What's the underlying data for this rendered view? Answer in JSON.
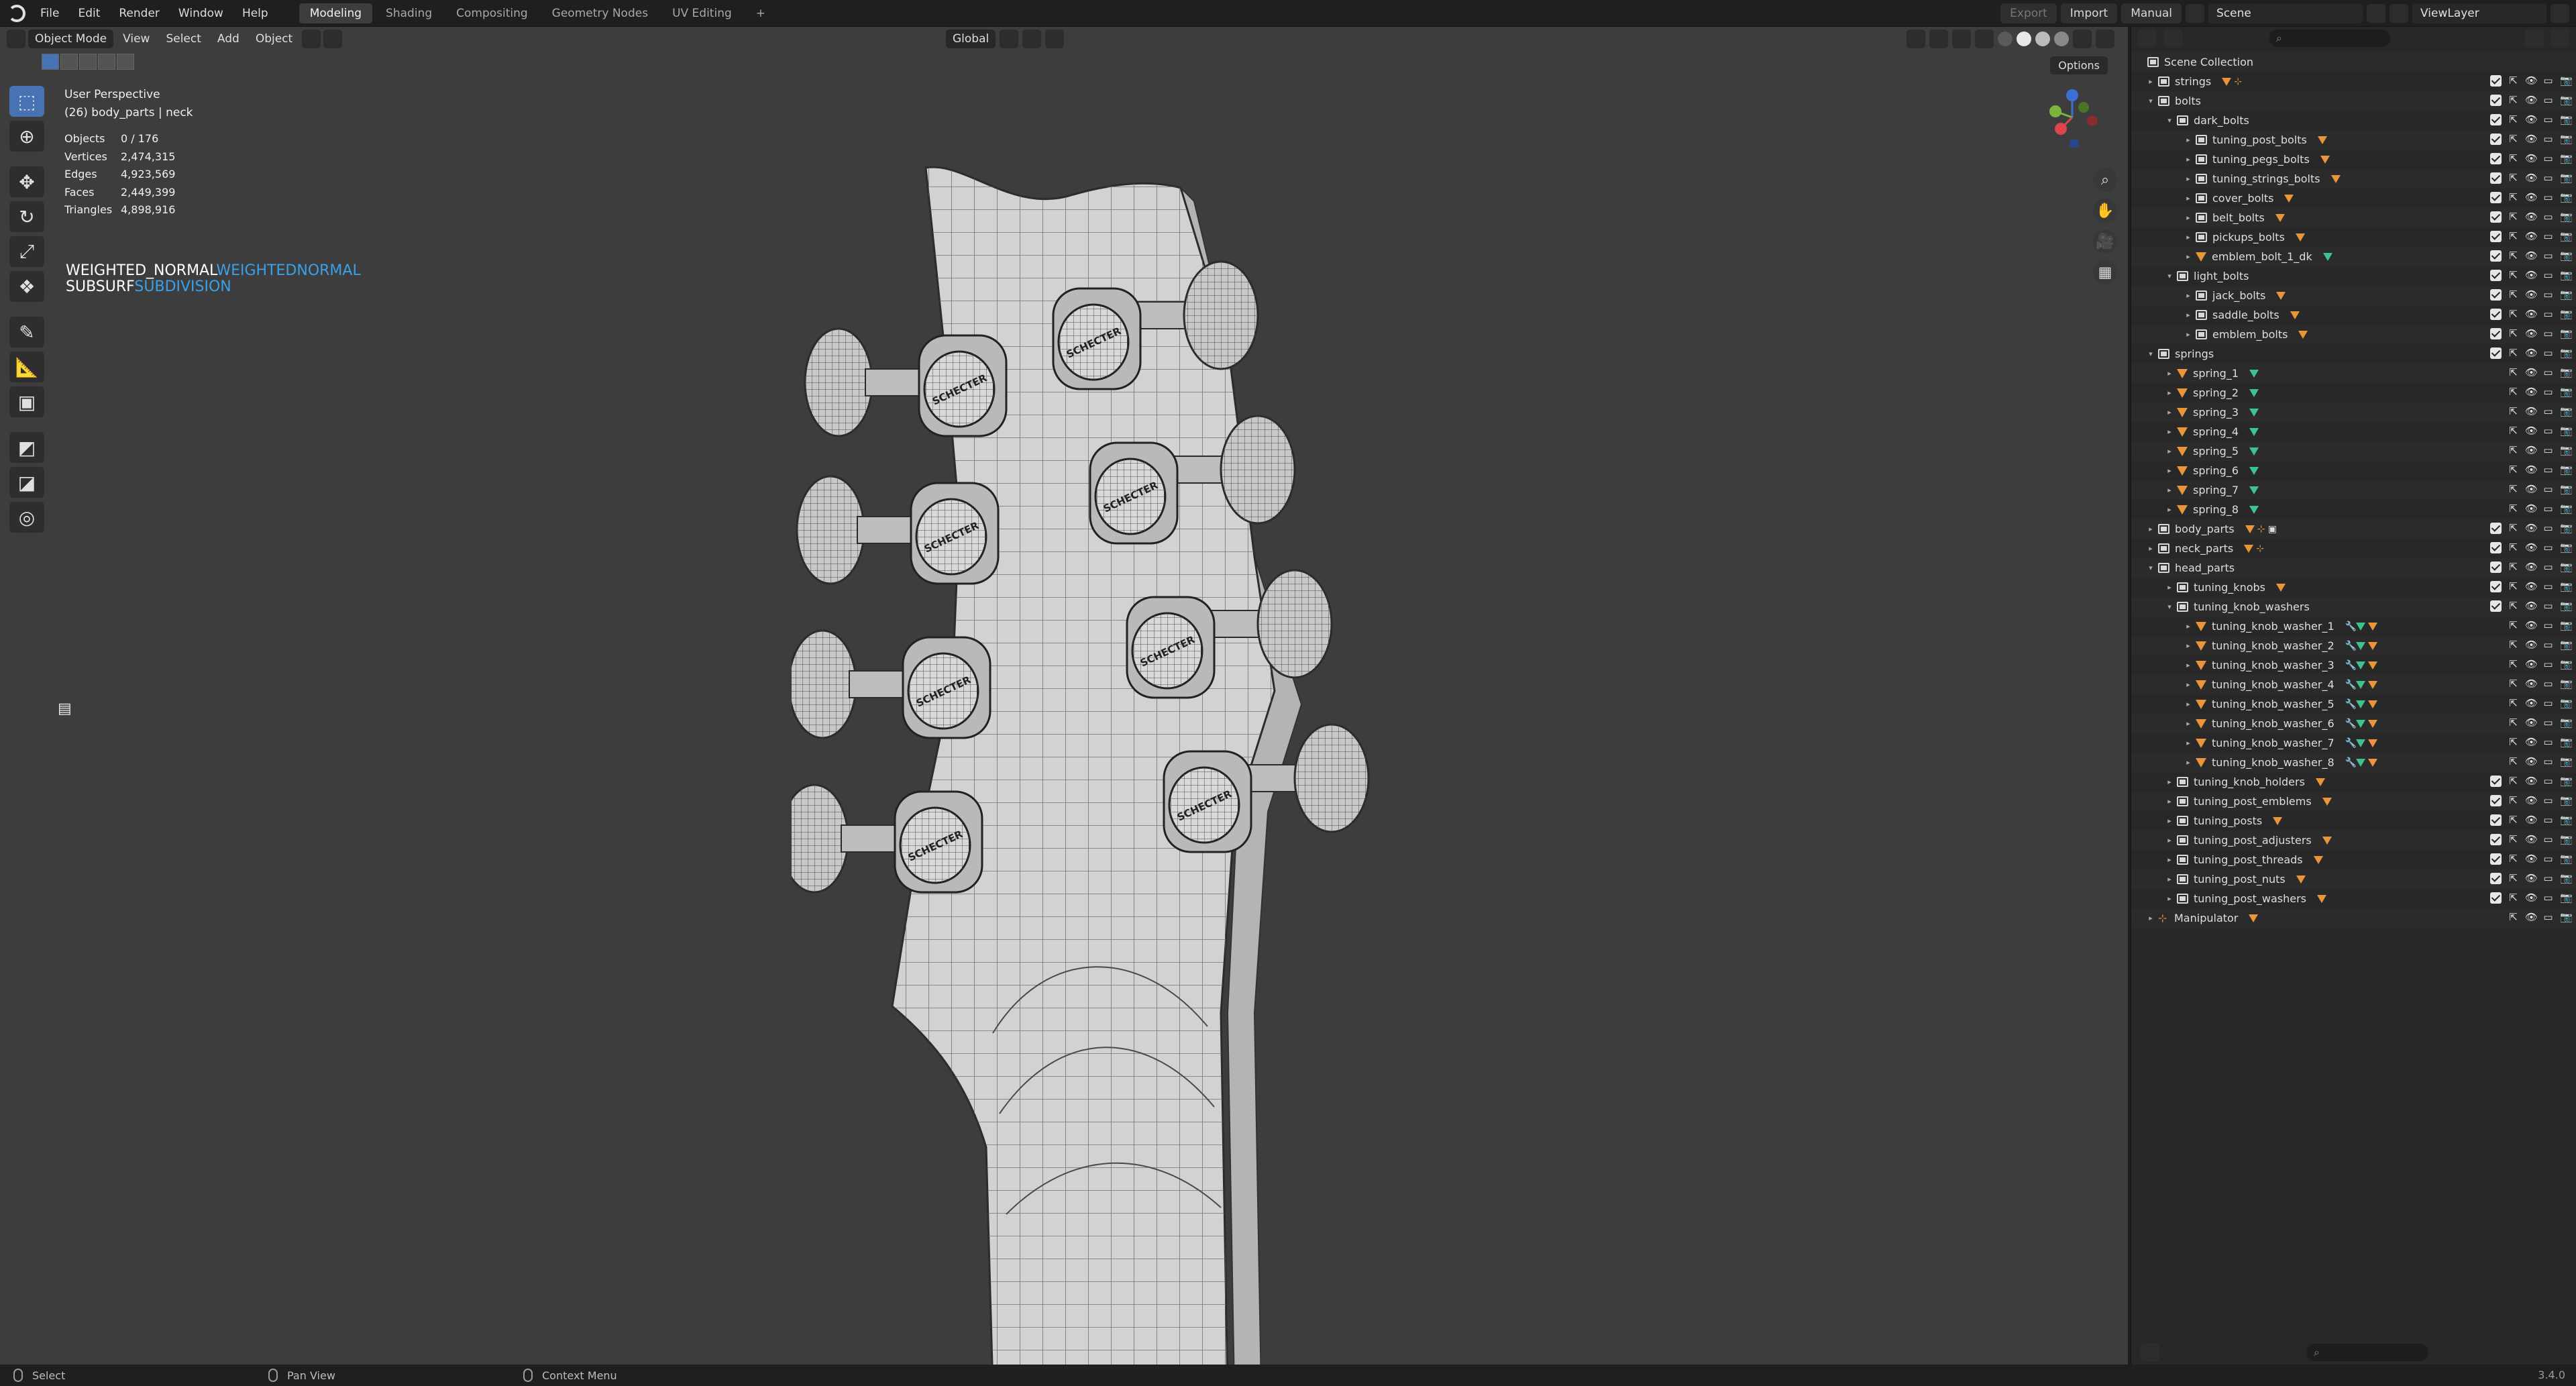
{
  "menu": {
    "items": [
      "File",
      "Edit",
      "Render",
      "Window",
      "Help"
    ],
    "workspaces": [
      "Modeling",
      "Shading",
      "Compositing",
      "Geometry Nodes",
      "UV Editing"
    ],
    "active_workspace": "Modeling",
    "add_workspace": "+"
  },
  "top_right": {
    "export_label": "Export",
    "import_label": "Import",
    "manual_label": "Manual",
    "scene_name": "Scene",
    "view_layer": "ViewLayer"
  },
  "viewport": {
    "mode": "Object Mode",
    "menus": [
      "View",
      "Select",
      "Add",
      "Object"
    ],
    "orientation": "Global",
    "options_label": "Options",
    "perspective": "User Perspective",
    "active_info": "(26) body_parts | neck",
    "stats": [
      {
        "label": "Objects",
        "value": "0 / 176"
      },
      {
        "label": "Vertices",
        "value": "2,474,315"
      },
      {
        "label": "Edges",
        "value": "4,923,569"
      },
      {
        "label": "Faces",
        "value": "2,449,399"
      },
      {
        "label": "Triangles",
        "value": "4,898,916"
      }
    ],
    "modifiers": [
      {
        "name": "WEIGHTED_NORMAL",
        "type": "WEIGHTEDNORMAL"
      },
      {
        "name": "SUBSURF",
        "type": "SUBDIVISION"
      }
    ],
    "emblem_text": "SCHECTER",
    "accent_color": "#4772b3"
  },
  "outliner": {
    "root": "Scene Collection",
    "rows": [
      {
        "label": "strings",
        "kind": "coll",
        "depth": 0,
        "arrow": "▸",
        "badges": [
          "m",
          "e"
        ],
        "check": true
      },
      {
        "label": "bolts",
        "kind": "coll",
        "depth": 0,
        "arrow": "▾",
        "badges": [],
        "check": true
      },
      {
        "label": "dark_bolts",
        "kind": "coll",
        "depth": 1,
        "arrow": "▾",
        "badges": [],
        "check": true
      },
      {
        "label": "tuning_post_bolts",
        "kind": "coll",
        "depth": 2,
        "arrow": "▸",
        "badges": [
          "m"
        ],
        "check": true
      },
      {
        "label": "tuning_pegs_bolts",
        "kind": "coll",
        "depth": 2,
        "arrow": "▸",
        "badges": [
          "m"
        ],
        "check": true
      },
      {
        "label": "tuning_strings_bolts",
        "kind": "coll",
        "depth": 2,
        "arrow": "▸",
        "badges": [
          "m"
        ],
        "check": true
      },
      {
        "label": "cover_bolts",
        "kind": "coll",
        "depth": 2,
        "arrow": "▸",
        "badges": [
          "m"
        ],
        "check": true
      },
      {
        "label": "belt_bolts",
        "kind": "coll",
        "depth": 2,
        "arrow": "▸",
        "badges": [
          "m"
        ],
        "check": true
      },
      {
        "label": "pickups_bolts",
        "kind": "coll",
        "depth": 2,
        "arrow": "▸",
        "badges": [
          "m"
        ],
        "check": true
      },
      {
        "label": "emblem_bolt_1_dk",
        "kind": "mesh",
        "depth": 2,
        "arrow": "▸",
        "badges": [
          "g"
        ],
        "check": true
      },
      {
        "label": "light_bolts",
        "kind": "coll",
        "depth": 1,
        "arrow": "▾",
        "badges": [],
        "check": true
      },
      {
        "label": "jack_bolts",
        "kind": "coll",
        "depth": 2,
        "arrow": "▸",
        "badges": [
          "m"
        ],
        "check": true
      },
      {
        "label": "saddle_bolts",
        "kind": "coll",
        "depth": 2,
        "arrow": "▸",
        "badges": [
          "m"
        ],
        "check": true
      },
      {
        "label": "emblem_bolts",
        "kind": "coll",
        "depth": 2,
        "arrow": "▸",
        "badges": [
          "m"
        ],
        "check": true
      },
      {
        "label": "springs",
        "kind": "coll",
        "depth": 0,
        "arrow": "▾",
        "badges": [],
        "check": true
      },
      {
        "label": "spring_1",
        "kind": "mesh",
        "depth": 1,
        "arrow": "▸",
        "badges": [
          "g"
        ],
        "check": false
      },
      {
        "label": "spring_2",
        "kind": "mesh",
        "depth": 1,
        "arrow": "▸",
        "badges": [
          "g"
        ],
        "check": false
      },
      {
        "label": "spring_3",
        "kind": "mesh",
        "depth": 1,
        "arrow": "▸",
        "badges": [
          "g"
        ],
        "check": false
      },
      {
        "label": "spring_4",
        "kind": "mesh",
        "depth": 1,
        "arrow": "▸",
        "badges": [
          "g"
        ],
        "check": false
      },
      {
        "label": "spring_5",
        "kind": "mesh",
        "depth": 1,
        "arrow": "▸",
        "badges": [
          "g"
        ],
        "check": false
      },
      {
        "label": "spring_6",
        "kind": "mesh",
        "depth": 1,
        "arrow": "▸",
        "badges": [
          "g"
        ],
        "check": false
      },
      {
        "label": "spring_7",
        "kind": "mesh",
        "depth": 1,
        "arrow": "▸",
        "badges": [
          "g"
        ],
        "check": false
      },
      {
        "label": "spring_8",
        "kind": "mesh",
        "depth": 1,
        "arrow": "▸",
        "badges": [
          "g"
        ],
        "check": false
      },
      {
        "label": "body_parts",
        "kind": "coll",
        "depth": 0,
        "arrow": "▸",
        "badges": [
          "m",
          "e",
          "c"
        ],
        "check": true
      },
      {
        "label": "neck_parts",
        "kind": "coll",
        "depth": 0,
        "arrow": "▸",
        "badges": [
          "m",
          "e"
        ],
        "check": true
      },
      {
        "label": "head_parts",
        "kind": "coll",
        "depth": 0,
        "arrow": "▾",
        "badges": [],
        "check": true
      },
      {
        "label": "tuning_knobs",
        "kind": "coll",
        "depth": 1,
        "arrow": "▸",
        "badges": [
          "m"
        ],
        "check": true
      },
      {
        "label": "tuning_knob_washers",
        "kind": "coll",
        "depth": 1,
        "arrow": "▾",
        "badges": [],
        "check": true
      },
      {
        "label": "tuning_knob_washer_1",
        "kind": "mesh",
        "depth": 2,
        "arrow": "▸",
        "badges": [
          "w",
          "g",
          "m"
        ],
        "check": false
      },
      {
        "label": "tuning_knob_washer_2",
        "kind": "mesh",
        "depth": 2,
        "arrow": "▸",
        "badges": [
          "w",
          "g",
          "m"
        ],
        "check": false
      },
      {
        "label": "tuning_knob_washer_3",
        "kind": "mesh",
        "depth": 2,
        "arrow": "▸",
        "badges": [
          "w",
          "g",
          "m"
        ],
        "check": false
      },
      {
        "label": "tuning_knob_washer_4",
        "kind": "mesh",
        "depth": 2,
        "arrow": "▸",
        "badges": [
          "w",
          "g",
          "m"
        ],
        "check": false
      },
      {
        "label": "tuning_knob_washer_5",
        "kind": "mesh",
        "depth": 2,
        "arrow": "▸",
        "badges": [
          "w",
          "g",
          "m"
        ],
        "check": false
      },
      {
        "label": "tuning_knob_washer_6",
        "kind": "mesh",
        "depth": 2,
        "arrow": "▸",
        "badges": [
          "w",
          "g",
          "m"
        ],
        "check": false
      },
      {
        "label": "tuning_knob_washer_7",
        "kind": "mesh",
        "depth": 2,
        "arrow": "▸",
        "badges": [
          "w",
          "g",
          "m"
        ],
        "check": false
      },
      {
        "label": "tuning_knob_washer_8",
        "kind": "mesh",
        "depth": 2,
        "arrow": "▸",
        "badges": [
          "w",
          "g",
          "m"
        ],
        "check": false
      },
      {
        "label": "tuning_knob_holders",
        "kind": "coll",
        "depth": 1,
        "arrow": "▸",
        "badges": [
          "m"
        ],
        "check": true
      },
      {
        "label": "tuning_post_emblems",
        "kind": "coll",
        "depth": 1,
        "arrow": "▸",
        "badges": [
          "m"
        ],
        "check": true
      },
      {
        "label": "tuning_posts",
        "kind": "coll",
        "depth": 1,
        "arrow": "▸",
        "badges": [
          "m"
        ],
        "check": true
      },
      {
        "label": "tuning_post_adjusters",
        "kind": "coll",
        "depth": 1,
        "arrow": "▸",
        "badges": [
          "m"
        ],
        "check": true
      },
      {
        "label": "tuning_post_threads",
        "kind": "coll",
        "depth": 1,
        "arrow": "▸",
        "badges": [
          "m"
        ],
        "check": true
      },
      {
        "label": "tuning_post_nuts",
        "kind": "coll",
        "depth": 1,
        "arrow": "▸",
        "badges": [
          "m"
        ],
        "check": true
      },
      {
        "label": "tuning_post_washers",
        "kind": "coll",
        "depth": 1,
        "arrow": "▸",
        "badges": [
          "m"
        ],
        "check": true
      },
      {
        "label": "Manipulator",
        "kind": "empty",
        "depth": 0,
        "arrow": "▸",
        "badges": [
          "m"
        ],
        "check": false
      }
    ]
  },
  "statusbar": {
    "select": "Select",
    "pan": "Pan View",
    "context": "Context Menu",
    "version": "3.4.0"
  }
}
